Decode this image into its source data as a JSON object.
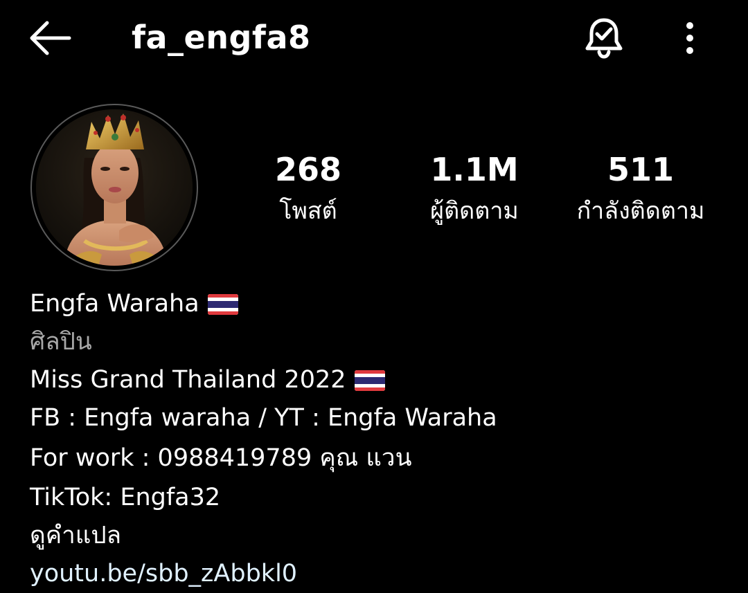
{
  "header": {
    "back_icon": "arrow-left-icon",
    "username": "fa_engfa8",
    "notification_icon": "bell-check-icon",
    "more_icon": "more-vertical-icon"
  },
  "profile": {
    "avatar_icon": "profile-photo",
    "stats": {
      "posts": {
        "value": "268",
        "label": "โพสต์"
      },
      "followers": {
        "value": "1.1M",
        "label": "ผู้ติดตาม"
      },
      "following": {
        "value": "511",
        "label": "กำลังติดตาม"
      }
    }
  },
  "bio": {
    "display_name": "Engfa Waraha",
    "category": "ศิลปิน",
    "line1": "Miss Grand Thailand 2022",
    "line2": "FB : Engfa waraha  / YT : Engfa Waraha",
    "line3": "For work : 0988419789 คุณ แวน",
    "line4": "TikTok: Engfa32",
    "translate_label": "ดูคำแปล",
    "link": "youtu.be/sbb_zAbbkl0",
    "flag_icon": "thailand-flag-icon"
  },
  "colors": {
    "background": "#000000",
    "text": "#ffffff",
    "secondary_text": "#a8a8a8",
    "link": "#e0f1ff"
  }
}
